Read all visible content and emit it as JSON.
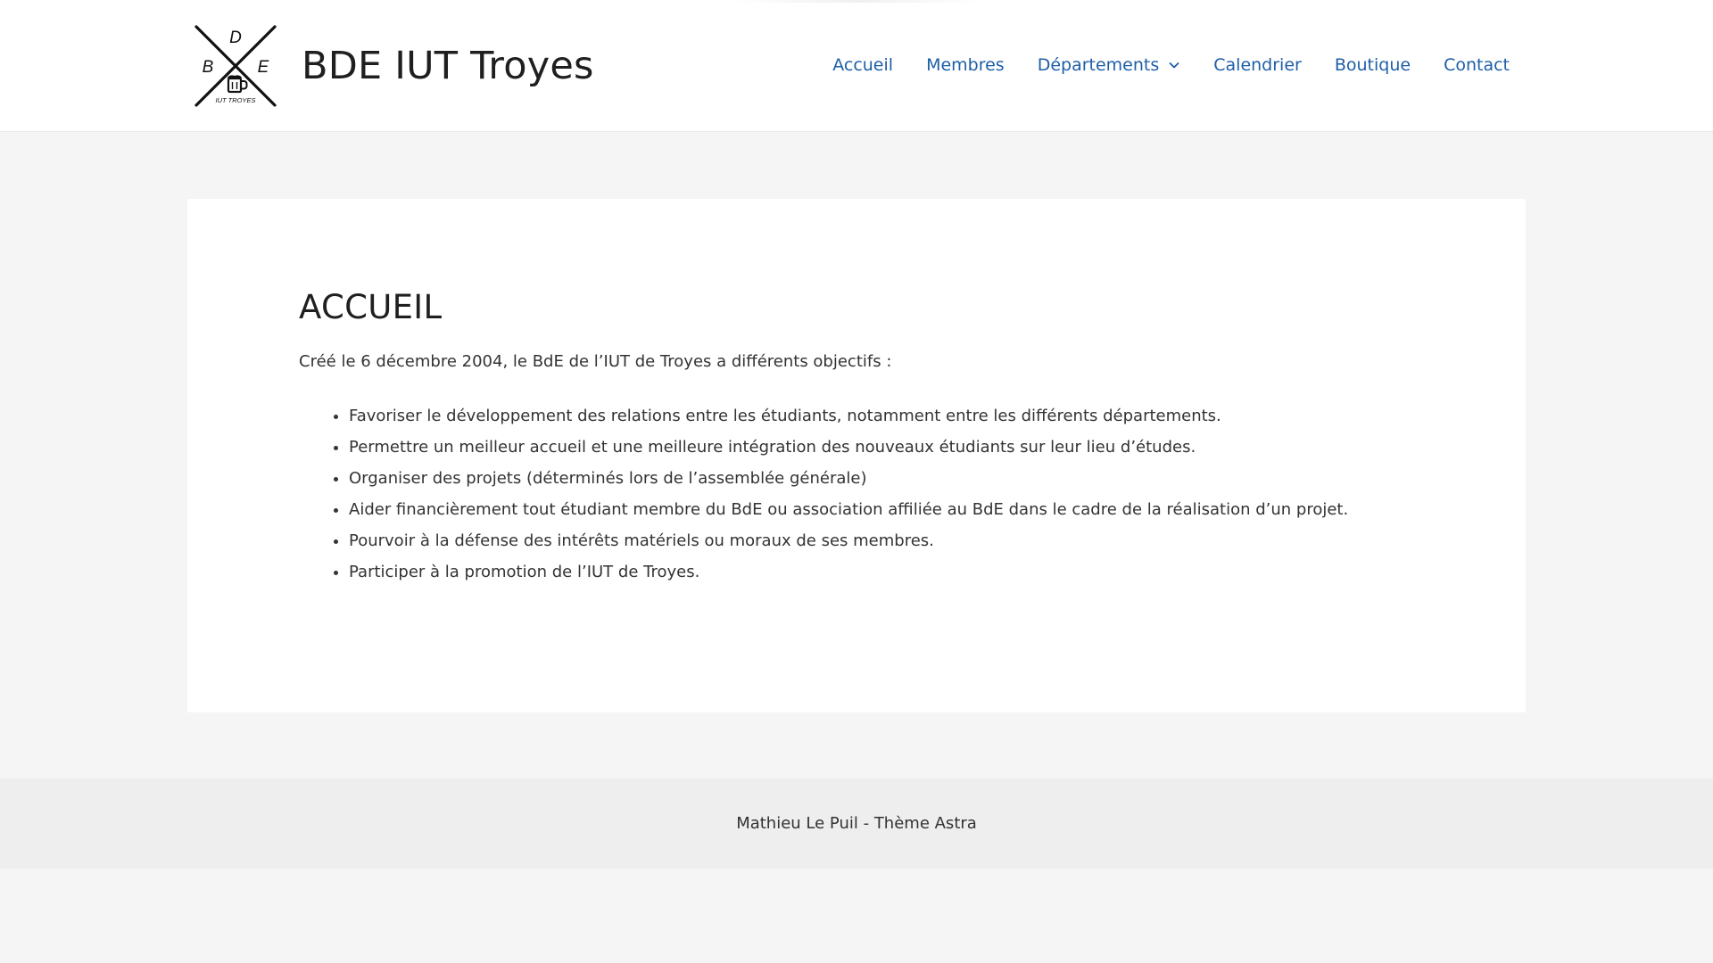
{
  "header": {
    "logo": {
      "letters": [
        "D",
        "B",
        "E"
      ],
      "tagline": "IUT TROYES"
    },
    "site_title": "BDE IUT Troyes",
    "nav": [
      {
        "label": "Accueil"
      },
      {
        "label": "Membres"
      },
      {
        "label": "Départements",
        "icon": "chevron-down-icon"
      },
      {
        "label": "Calendrier"
      },
      {
        "label": "Boutique"
      },
      {
        "label": "Contact"
      }
    ]
  },
  "main": {
    "title": "ACCUEIL",
    "intro": "Créé le 6 décembre 2004, le BdE de l’IUT de Troyes a différents objectifs :",
    "objectives": [
      "Favoriser le développement des relations entre les étudiants, notamment entre les différents départements.",
      "Permettre un meilleur accueil et une meilleure intégration des nouveaux étudiants sur leur lieu d’études.",
      "Organiser des projets (déterminés lors de l’assemblée générale)",
      "Aider financièrement tout étudiant membre du BdE ou association affiliée au BdE dans le cadre de la réalisation d’un projet.",
      "Pourvoir à la défense des intérêts matériels ou moraux de ses membres.",
      "Participer à la promotion de l’IUT de Troyes."
    ]
  },
  "footer": {
    "text": "Mathieu Le Puil - Thème Astra"
  },
  "colors": {
    "nav_link": "#1e5ea8",
    "page_background": "#f5f5f5",
    "footer_background": "#eeeeee"
  }
}
